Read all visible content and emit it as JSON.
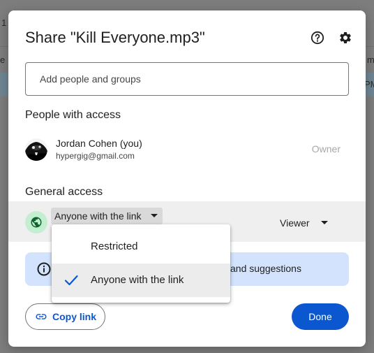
{
  "background": {
    "fragments": [
      "1",
      "e",
      "m",
      "PM"
    ]
  },
  "dialog": {
    "title": "Share \"Kill Everyone.mp3\"",
    "help_icon": "help-circle-icon",
    "settings_icon": "gear-icon",
    "add_people": {
      "placeholder": "Add people and groups",
      "value": ""
    },
    "people_section": {
      "title": "People with access",
      "people": [
        {
          "name": "Jordan Cohen (you)",
          "email": "hypergig@gmail.com",
          "role": "Owner"
        }
      ]
    },
    "general_access": {
      "title": "General access",
      "icon": "globe-icon",
      "selected": "Anyone with the link",
      "role": "Viewer",
      "options": [
        "Restricted",
        "Anyone with the link"
      ]
    },
    "info_banner": {
      "icon": "info-icon",
      "text": "and suggestions"
    },
    "copy_link": {
      "icon": "link-icon",
      "label": "Copy link"
    },
    "done": {
      "label": "Done"
    }
  },
  "colors": {
    "accent": "#0b57d0",
    "banner": "#d3e3fd",
    "globe_bg": "#c4eed0",
    "selected_row": "#efefef"
  }
}
